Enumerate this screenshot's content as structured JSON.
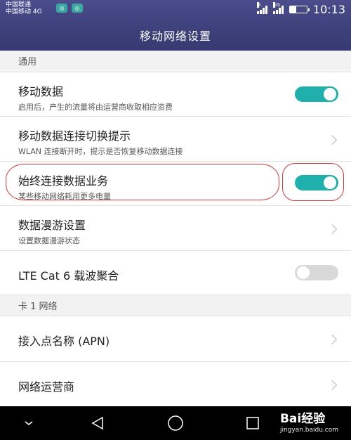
{
  "status_bar": {
    "carrier_1": "中国联通",
    "carrier_2": "中国移动 4G",
    "net_1": "G",
    "net_2": "4G",
    "time": "10:13"
  },
  "header": {
    "title": "移动网络设置"
  },
  "sections": {
    "general": {
      "label": "通用"
    },
    "sim1": {
      "label": "卡 1 网络"
    }
  },
  "items": {
    "mobile_data": {
      "title": "移动数据",
      "subtitle": "启用后，产生的流量将由运营商收取相应资费",
      "toggle": "on"
    },
    "switch_hint": {
      "title": "移动数据连接切换提示",
      "subtitle": "WLAN 连接断开时，提示是否恢复移动数据连接"
    },
    "always_on": {
      "title": "始终连接数据业务",
      "subtitle": "某些移动网络耗用更多电量",
      "toggle": "on"
    },
    "roaming": {
      "title": "数据漫游设置",
      "subtitle": "设置数据漫游状态"
    },
    "lte_ca": {
      "title": "LTE Cat 6 载波聚合",
      "toggle": "off"
    },
    "apn": {
      "title": "接入点名称 (APN)"
    },
    "operator": {
      "title": "网络运营商"
    }
  },
  "watermark": {
    "brand": "Bai经验",
    "url": "jingyan.baidu.com"
  },
  "colors": {
    "header": "#3f4180",
    "toggle_on": "#1fb0ac",
    "toggle_off": "#d9d9d9",
    "annotation": "#d43a3a"
  }
}
